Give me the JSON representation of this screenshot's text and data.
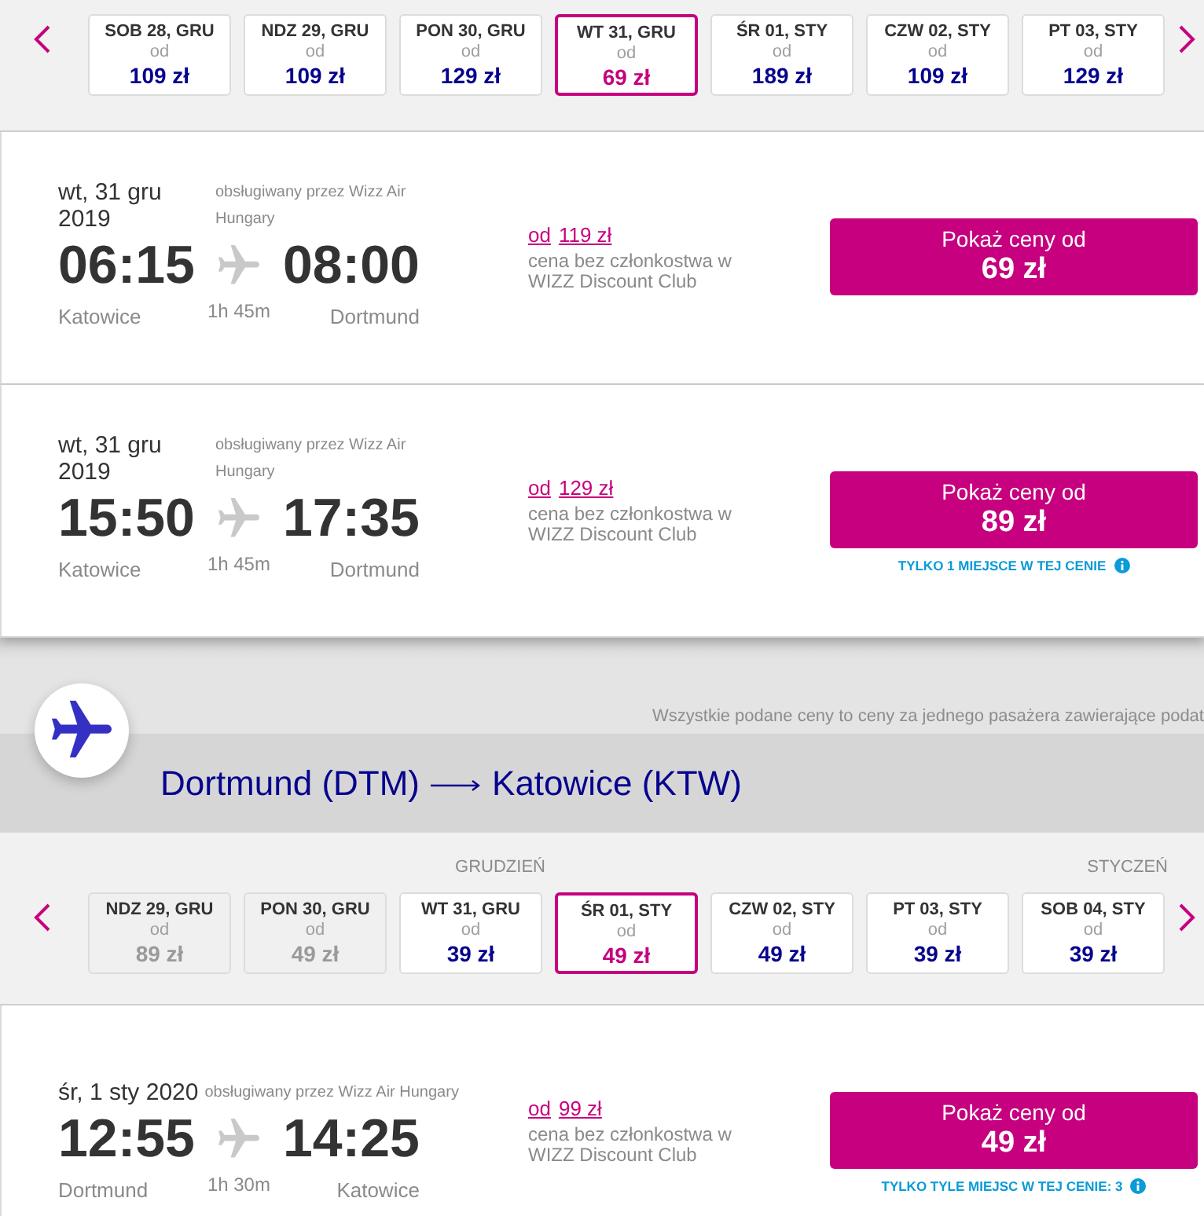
{
  "outbound_dates": {
    "days": [
      {
        "label": "SOB 28, GRU",
        "from": "od",
        "price": "109 zł",
        "selected": false,
        "disabled": false
      },
      {
        "label": "NDZ 29, GRU",
        "from": "od",
        "price": "109 zł",
        "selected": false,
        "disabled": false
      },
      {
        "label": "PON 30, GRU",
        "from": "od",
        "price": "129 zł",
        "selected": false,
        "disabled": false
      },
      {
        "label": "WT 31, GRU",
        "from": "od",
        "price": "69 zł",
        "selected": true,
        "disabled": false
      },
      {
        "label": "ŚR 01, STY",
        "from": "od",
        "price": "189 zł",
        "selected": false,
        "disabled": false
      },
      {
        "label": "CZW 02, STY",
        "from": "od",
        "price": "109 zł",
        "selected": false,
        "disabled": false
      },
      {
        "label": "PT 03, STY",
        "from": "od",
        "price": "129 zł",
        "selected": false,
        "disabled": false
      }
    ]
  },
  "outbound_flights": [
    {
      "date": "wt, 31 gru 2019",
      "operator": "obsługiwany przez Wizz Air Hungary",
      "departure_time": "06:15",
      "arrival_time": "08:00",
      "origin": "Katowice",
      "duration": "1h 45m",
      "destination": "Dortmund",
      "regular_price": {
        "prefix": "od",
        "amount": "119 zł"
      },
      "regular_price_note": "cena bez członkostwa w WIZZ Discount Club",
      "button": {
        "label": "Pokaż ceny od",
        "price": "69 zł"
      }
    },
    {
      "date": "wt, 31 gru 2019",
      "operator": "obsługiwany przez Wizz Air Hungary",
      "departure_time": "15:50",
      "arrival_time": "17:35",
      "origin": "Katowice",
      "duration": "1h 45m",
      "destination": "Dortmund",
      "regular_price": {
        "prefix": "od",
        "amount": "129 zł"
      },
      "regular_price_note": "cena bez członkostwa w WIZZ Discount Club",
      "button": {
        "label": "Pokaż ceny od",
        "price": "89 zł"
      },
      "seats_note": "TYLKO 1 MIEJSCE W TEJ CENIE"
    }
  ],
  "fare_note": "Wszystkie podane ceny to ceny za jednego pasażera zawierające podat",
  "return_route": {
    "origin": "Dortmund (DTM)",
    "destination": "Katowice (KTW)"
  },
  "return_dates": {
    "months": [
      {
        "label": "GRUDZIEŃ",
        "days": [
          {
            "label": "NDZ 29, GRU",
            "from": "od",
            "price": "89 zł",
            "selected": false,
            "disabled": true
          },
          {
            "label": "PON 30, GRU",
            "from": "od",
            "price": "49 zł",
            "selected": false,
            "disabled": true
          },
          {
            "label": "WT 31, GRU",
            "from": "od",
            "price": "39 zł",
            "selected": false,
            "disabled": false
          }
        ]
      },
      {
        "label": "STYCZEŃ",
        "days": [
          {
            "label": "ŚR 01, STY",
            "from": "od",
            "price": "49 zł",
            "selected": true,
            "disabled": false
          },
          {
            "label": "CZW 02, STY",
            "from": "od",
            "price": "49 zł",
            "selected": false,
            "disabled": false
          },
          {
            "label": "PT 03, STY",
            "from": "od",
            "price": "39 zł",
            "selected": false,
            "disabled": false
          },
          {
            "label": "SOB 04, STY",
            "from": "od",
            "price": "39 zł",
            "selected": false,
            "disabled": false
          }
        ]
      }
    ]
  },
  "return_flights": [
    {
      "date": "śr, 1 sty 2020",
      "operator": "obsługiwany przez Wizz Air Hungary",
      "departure_time": "12:55",
      "arrival_time": "14:25",
      "origin": "Dortmund",
      "duration": "1h 30m",
      "destination": "Katowice",
      "regular_price": {
        "prefix": "od",
        "amount": "99 zł"
      },
      "regular_price_note": "cena bez członkostwa w WIZZ Discount Club",
      "button": {
        "label": "Pokaż ceny od",
        "price": "49 zł"
      },
      "seats_note": "TYLKO TYLE MIEJSC W TEJ CENIE: 3"
    }
  ]
}
